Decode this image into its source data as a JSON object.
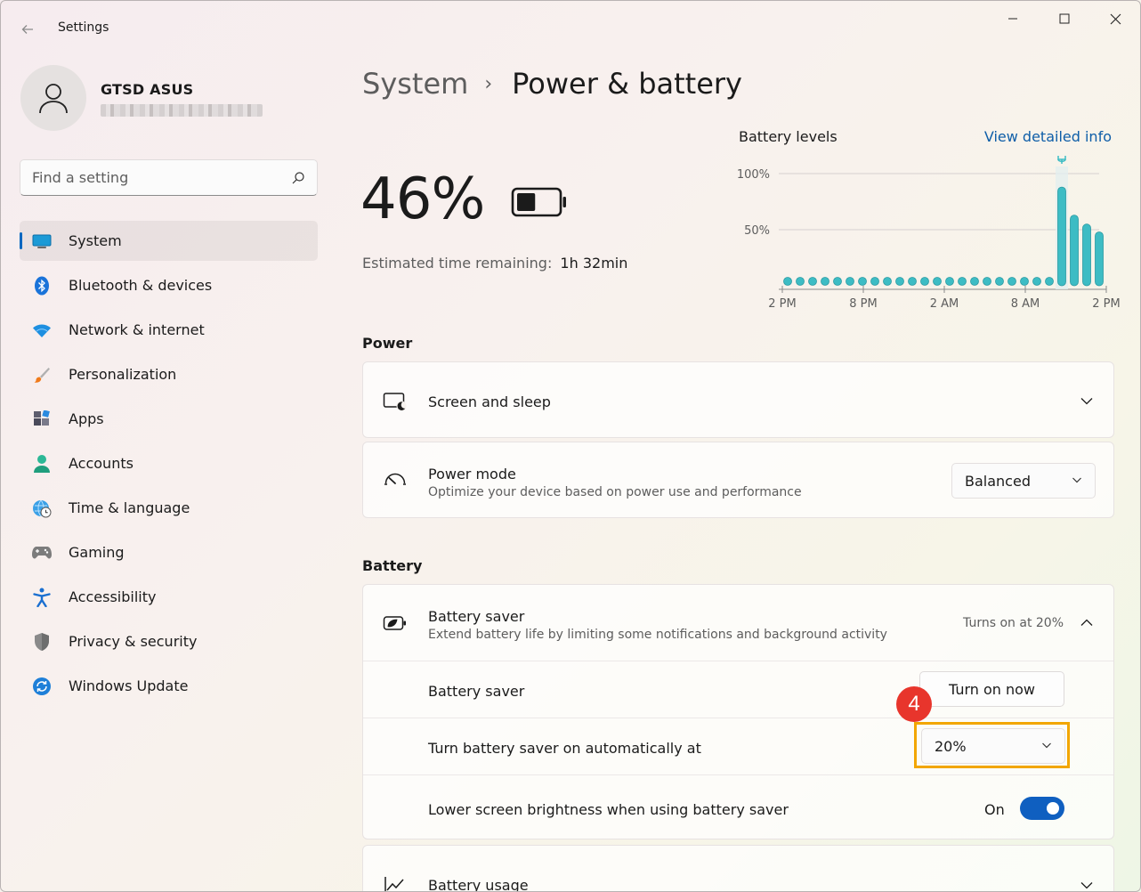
{
  "window": {
    "app_title": "Settings"
  },
  "profile": {
    "name": "GTSD ASUS"
  },
  "search": {
    "placeholder": "Find a setting"
  },
  "sidebar": {
    "items": [
      {
        "label": "System",
        "icon": "system-icon"
      },
      {
        "label": "Bluetooth & devices",
        "icon": "bluetooth-icon"
      },
      {
        "label": "Network & internet",
        "icon": "wifi-icon"
      },
      {
        "label": "Personalization",
        "icon": "brush-icon"
      },
      {
        "label": "Apps",
        "icon": "apps-icon"
      },
      {
        "label": "Accounts",
        "icon": "accounts-icon"
      },
      {
        "label": "Time & language",
        "icon": "globe-clock-icon"
      },
      {
        "label": "Gaming",
        "icon": "gamepad-icon"
      },
      {
        "label": "Accessibility",
        "icon": "accessibility-icon"
      },
      {
        "label": "Privacy & security",
        "icon": "shield-icon"
      },
      {
        "label": "Windows Update",
        "icon": "update-icon"
      }
    ],
    "active_index": 0
  },
  "header": {
    "parent": "System",
    "separator": "›",
    "current": "Power & battery"
  },
  "battery": {
    "percent_label": "46%",
    "level": 0.46,
    "estimated_label": "Estimated time remaining:",
    "estimated_value": "1h 32min"
  },
  "chart_data": {
    "type": "bar",
    "title": "Battery levels",
    "link_label": "View detailed info",
    "y_ticks": [
      "100%",
      "50%"
    ],
    "y_tick_values": [
      100,
      50
    ],
    "ylim": [
      0,
      100
    ],
    "x_tick_labels": [
      "2 PM",
      "8 PM",
      "2 AM",
      "8 AM",
      "2 PM"
    ],
    "x_tick_index": [
      0,
      6,
      12,
      18,
      24
    ],
    "values": [
      0,
      0,
      0,
      0,
      0,
      0,
      0,
      0,
      0,
      0,
      0,
      0,
      0,
      0,
      0,
      0,
      0,
      0,
      0,
      0,
      0,
      0,
      88,
      63,
      55,
      48
    ],
    "charging_index": 21,
    "accent": "#3dbcc4"
  },
  "power": {
    "section_label": "Power",
    "screen_sleep_label": "Screen and sleep",
    "power_mode_label": "Power mode",
    "power_mode_desc": "Optimize your device based on power use and performance",
    "power_mode_value": "Balanced"
  },
  "battery_section": {
    "section_label": "Battery",
    "saver_title": "Battery saver",
    "saver_desc": "Extend battery life by limiting some notifications and background activity",
    "saver_status": "Turns on at 20%",
    "saver_row_label": "Battery saver",
    "turn_on_now_label": "Turn on now",
    "auto_label": "Turn battery saver on automatically at",
    "auto_value": "20%",
    "brightness_label": "Lower screen brightness when using battery saver",
    "brightness_state": "On",
    "usage_label": "Battery usage",
    "step_number": "4",
    "highlight_color": "#f2a600",
    "badge_color": "#e8352c"
  }
}
